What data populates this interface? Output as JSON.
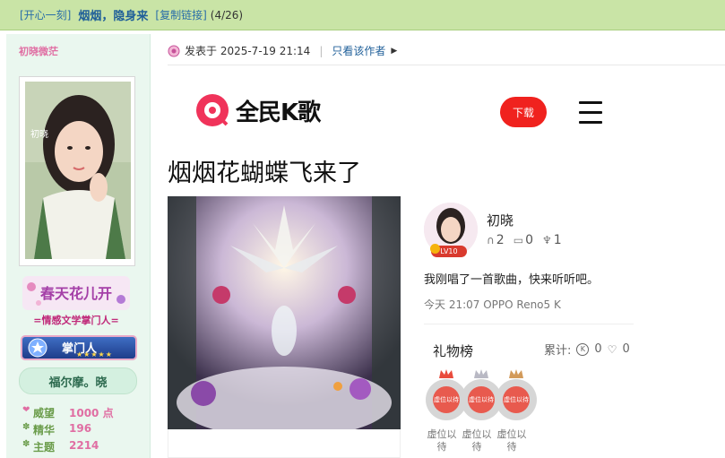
{
  "topbar": {
    "category": "[开心一刻]",
    "title": "烟烟，隐身来",
    "copy_link": "[复制链接]",
    "page": "(4/26)"
  },
  "sidebar": {
    "username": "初晓微茫",
    "avatar_caption": "初晓",
    "badge_art_text": "春天花儿开",
    "section": "=情感文学掌门人=",
    "rank": "掌门人",
    "rank_stars": "★★★★★",
    "title": "福尔摩。晓",
    "stats": [
      {
        "key": "威望",
        "value": "1000 点"
      },
      {
        "key": "精华",
        "value": "196"
      },
      {
        "key": "主题",
        "value": "2214"
      }
    ]
  },
  "post": {
    "posted_label": "发表于 2025-7-19 21:14",
    "separator": "|",
    "only_author": "只看该作者"
  },
  "karaoke": {
    "brand": "全民K歌",
    "download": "下载",
    "song_title": "烟烟花蝴蝶飞来了",
    "user": {
      "name": "初晓",
      "level": "LV10",
      "listens": "2",
      "comments": "0",
      "gifts": "1"
    },
    "message": "我刚唱了一首歌曲，快来听听吧。",
    "device": "今天 21:07 OPPO Reno5 K",
    "gift_board": "礼物榜",
    "total_label": "累计:",
    "total_coins": "0",
    "total_flowers": "0",
    "seat_text": "虚位以待",
    "seat_label": "虚位以待"
  },
  "colors": {
    "topbar_bg": "#c9e4a6",
    "sidebar_bg": "#eaf7ef",
    "accent_pink": "#e06ea3",
    "download_red": "#f0221e"
  }
}
